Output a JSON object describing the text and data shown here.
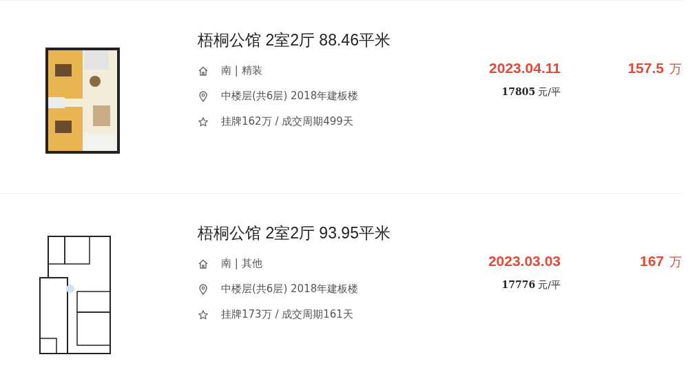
{
  "listings": [
    {
      "title": "梧桐公馆 2室2厅 88.46平米",
      "info": [
        "南 | 精装",
        "中楼层(共6层) 2018年建板楼",
        "挂牌162万 / 成交周期499天"
      ],
      "deal_date": "2023.04.11",
      "total_price": "157.5",
      "total_unit": "万",
      "unit_price": "17805",
      "unit_price_unit": "元/平"
    },
    {
      "title": "梧桐公馆 2室2厅 93.95平米",
      "info": [
        "南 | 其他",
        "中楼层(共6层) 2018年建板楼",
        "挂牌173万 / 成交周期161天"
      ],
      "deal_date": "2023.03.03",
      "total_price": "167",
      "total_unit": "万",
      "unit_price": "17776",
      "unit_price_unit": "元/平"
    }
  ]
}
